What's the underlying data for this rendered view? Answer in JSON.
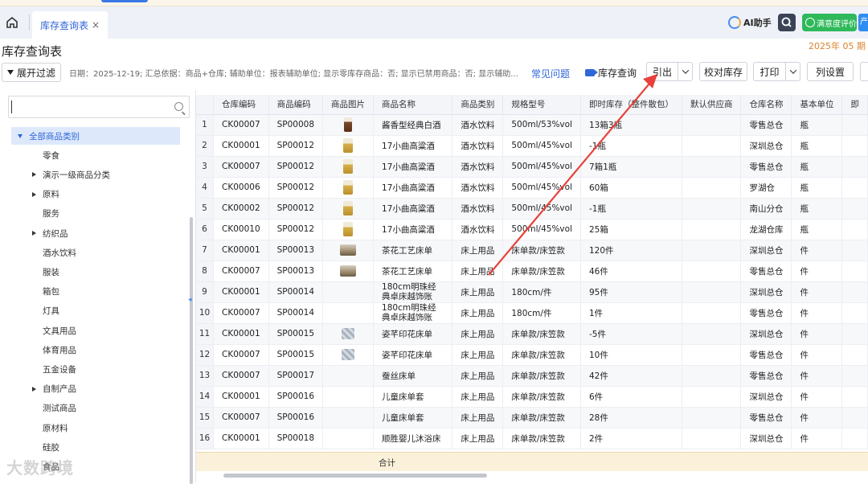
{
  "tabs": {
    "active_label": "库存查询表",
    "close_glyph": "×"
  },
  "header": {
    "ai_helper": "AI助手",
    "satisfaction": "满意度评价",
    "edge_label": "产"
  },
  "page": {
    "title": "库存查询表",
    "date_right": "2025年 05 期",
    "date_right_sep": "|"
  },
  "toolbar": {
    "expand_filter": "展开过滤",
    "summary": "日期：2025-12-19; 汇总依据：商品+仓库; 辅助单位：报表辅助单位; 显示零库存商品：否; 显示已禁用商品：否; 显示辅助...",
    "faq": "常见问题",
    "inventory_query": "库存查询",
    "export": "引出",
    "reconcile": "校对库存",
    "print": "打印",
    "column_settings": "列设置"
  },
  "tree": {
    "search_placeholder": "",
    "items": [
      {
        "label": "全部商品类别",
        "expander": "open",
        "level": 0
      },
      {
        "label": "零食",
        "expander": "none",
        "level": 1
      },
      {
        "label": "演示一级商品分类",
        "expander": "closed",
        "level": 1
      },
      {
        "label": "原料",
        "expander": "closed",
        "level": 1
      },
      {
        "label": "服务",
        "expander": "none",
        "level": 1
      },
      {
        "label": "纺织品",
        "expander": "closed",
        "level": 1
      },
      {
        "label": "酒水饮料",
        "expander": "none",
        "level": 1
      },
      {
        "label": "服装",
        "expander": "none",
        "level": 1
      },
      {
        "label": "箱包",
        "expander": "none",
        "level": 1
      },
      {
        "label": "灯具",
        "expander": "none",
        "level": 1
      },
      {
        "label": "文具用品",
        "expander": "none",
        "level": 1
      },
      {
        "label": "体育用品",
        "expander": "none",
        "level": 1
      },
      {
        "label": "五金设备",
        "expander": "none",
        "level": 1
      },
      {
        "label": "自制产品",
        "expander": "closed",
        "level": 1
      },
      {
        "label": "测试商品",
        "expander": "none",
        "level": 1
      },
      {
        "label": "原材料",
        "expander": "none",
        "level": 1
      },
      {
        "label": "硅胶",
        "expander": "none",
        "level": 1
      },
      {
        "label": "食品",
        "expander": "none",
        "level": 1
      }
    ]
  },
  "table": {
    "columns": [
      "",
      "仓库编码",
      "商品编码",
      "商品图片",
      "商品名称",
      "商品类别",
      "规格型号",
      "即时库存（整件散包）",
      "默认供应商",
      "仓库名称",
      "基本单位",
      "即"
    ],
    "rows": [
      {
        "no": "1",
        "wh_code": "CK00007",
        "sku": "SP00008",
        "img": "bottle",
        "name": "酱香型经典白酒",
        "cat": "酒水饮料",
        "spec": "500ml/53%vol",
        "stock": "13箱3瓶",
        "supplier": "",
        "wh_name": "零售总仓",
        "unit": "瓶"
      },
      {
        "no": "2",
        "wh_code": "CK00001",
        "sku": "SP00012",
        "img": "gold",
        "name": "17小曲高粱酒",
        "cat": "酒水饮料",
        "spec": "500ml/45%vol",
        "stock": "-1瓶",
        "supplier": "",
        "wh_name": "深圳总仓",
        "unit": "瓶"
      },
      {
        "no": "3",
        "wh_code": "CK00007",
        "sku": "SP00012",
        "img": "gold",
        "name": "17小曲高粱酒",
        "cat": "酒水饮料",
        "spec": "500ml/45%vol",
        "stock": "7箱1瓶",
        "supplier": "",
        "wh_name": "零售总仓",
        "unit": "瓶"
      },
      {
        "no": "4",
        "wh_code": "CK00006",
        "sku": "SP00012",
        "img": "gold",
        "name": "17小曲高粱酒",
        "cat": "酒水饮料",
        "spec": "500ml/45%vol",
        "stock": "60箱",
        "supplier": "",
        "wh_name": "罗湖仓",
        "unit": "瓶"
      },
      {
        "no": "5",
        "wh_code": "CK00002",
        "sku": "SP00012",
        "img": "gold",
        "name": "17小曲高粱酒",
        "cat": "酒水饮料",
        "spec": "500ml/45%vol",
        "stock": "-1瓶",
        "supplier": "",
        "wh_name": "南山分仓",
        "unit": "瓶"
      },
      {
        "no": "6",
        "wh_code": "CK00010",
        "sku": "SP00012",
        "img": "gold",
        "name": "17小曲高粱酒",
        "cat": "酒水饮料",
        "spec": "500ml/45%vol",
        "stock": "25箱",
        "supplier": "",
        "wh_name": "龙湖仓库",
        "unit": "瓶"
      },
      {
        "no": "7",
        "wh_code": "CK00001",
        "sku": "SP00013",
        "img": "bed",
        "name": "茶花工艺床单",
        "cat": "床上用品",
        "spec": "床单款/床笠款",
        "stock": "120件",
        "supplier": "",
        "wh_name": "深圳总仓",
        "unit": "件"
      },
      {
        "no": "8",
        "wh_code": "CK00007",
        "sku": "SP00013",
        "img": "bed",
        "name": "茶花工艺床单",
        "cat": "床上用品",
        "spec": "床单款/床笠款",
        "stock": "46件",
        "supplier": "",
        "wh_name": "零售总仓",
        "unit": "件"
      },
      {
        "no": "9",
        "wh_code": "CK00001",
        "sku": "SP00014",
        "img": "",
        "name": "180cm明珠经典卓床越饰账",
        "cat": "床上用品",
        "spec": "180cm/件",
        "stock": "95件",
        "supplier": "",
        "wh_name": "深圳总仓",
        "unit": "件"
      },
      {
        "no": "10",
        "wh_code": "CK00007",
        "sku": "SP00014",
        "img": "",
        "name": "180cm明珠经典卓床越饰账",
        "cat": "床上用品",
        "spec": "180cm/件",
        "stock": "1件",
        "supplier": "",
        "wh_name": "零售总仓",
        "unit": "件"
      },
      {
        "no": "11",
        "wh_code": "CK00001",
        "sku": "SP00015",
        "img": "pattern",
        "name": "姿芊印花床单",
        "cat": "床上用品",
        "spec": "床单款/床笠款",
        "stock": "-5件",
        "supplier": "",
        "wh_name": "深圳总仓",
        "unit": "件"
      },
      {
        "no": "12",
        "wh_code": "CK00007",
        "sku": "SP00015",
        "img": "pattern",
        "name": "姿芊印花床单",
        "cat": "床上用品",
        "spec": "床单款/床笠款",
        "stock": "10件",
        "supplier": "",
        "wh_name": "零售总仓",
        "unit": "件"
      },
      {
        "no": "13",
        "wh_code": "CK00007",
        "sku": "SP00017",
        "img": "",
        "name": "蚕丝床单",
        "cat": "床上用品",
        "spec": "床单款/床笠款",
        "stock": "42件",
        "supplier": "",
        "wh_name": "零售总仓",
        "unit": "件"
      },
      {
        "no": "14",
        "wh_code": "CK00001",
        "sku": "SP00016",
        "img": "",
        "name": "儿童床单套",
        "cat": "床上用品",
        "spec": "床单款/床笠款",
        "stock": "6件",
        "supplier": "",
        "wh_name": "深圳总仓",
        "unit": "件"
      },
      {
        "no": "15",
        "wh_code": "CK00007",
        "sku": "SP00016",
        "img": "",
        "name": "儿童床单套",
        "cat": "床上用品",
        "spec": "床单款/床笠款",
        "stock": "28件",
        "supplier": "",
        "wh_name": "零售总仓",
        "unit": "件"
      },
      {
        "no": "16",
        "wh_code": "CK00001",
        "sku": "SP00018",
        "img": "",
        "name": "顺胜婴儿沐浴床",
        "cat": "床上用品",
        "spec": "床单款/床笠款",
        "stock": "2件",
        "supplier": "",
        "wh_name": "深圳总仓",
        "unit": "件"
      }
    ],
    "total_label": "合计"
  },
  "watermark": "大数跨境",
  "annotation": {
    "arrow_color": "#e8413b",
    "points_to": "export-button"
  },
  "colors": {
    "accent": "#2f66d8",
    "satisfaction_green": "#2eb95a",
    "date_orange": "#d9822b",
    "total_row_bg": "#fbf1da"
  }
}
